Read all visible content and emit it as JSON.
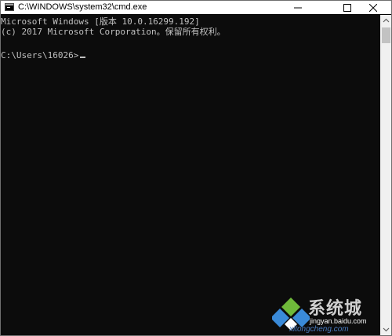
{
  "window": {
    "title": "C:\\WINDOWS\\system32\\cmd.exe",
    "minimize_glyph": "—",
    "close_glyph": "✕"
  },
  "console": {
    "line1": "Microsoft Windows [版本 10.0.16299.192]",
    "line2": "(c) 2017 Microsoft Corporation。保留所有权利。",
    "prompt": "C:\\Users\\16026>"
  },
  "watermark": {
    "name": "系统城",
    "site": "jingyan.baidu.com",
    "domain": "xitongcheng.com"
  },
  "colors": {
    "console_bg": "#0c0c0c",
    "console_text": "#c0c0c0",
    "titlebar_bg": "#ffffff",
    "scrollbar_bg": "#f0f0f0",
    "watermark_blue": "#3a8ad8",
    "watermark_green": "#6fb93a"
  },
  "icons": {
    "app": "cmd-icon",
    "minimize": "minimize-icon",
    "maximize": "maximize-icon",
    "close": "close-icon",
    "scroll_up": "chevron-up-icon",
    "scroll_down": "chevron-down-icon"
  }
}
